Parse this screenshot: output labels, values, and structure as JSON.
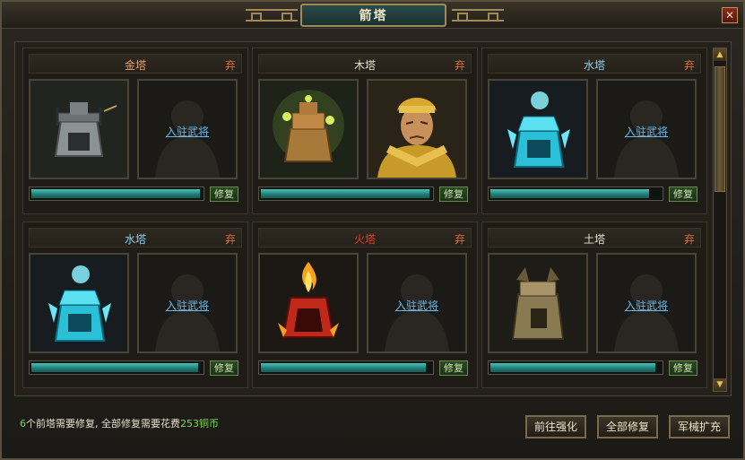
{
  "window": {
    "title": "箭塔",
    "close_label": "✕"
  },
  "towers": [
    {
      "name": "金塔",
      "name_color": "#e8a060",
      "drop_label": "弃",
      "tower_icon": "metal-tower-icon",
      "has_general": false,
      "assign_label": "入驻武将",
      "repair_label": "修复",
      "durability": 0.99
    },
    {
      "name": "木塔",
      "name_color": "#e8e0cc",
      "drop_label": "弃",
      "tower_icon": "wood-tower-icon",
      "has_general": true,
      "general_icon": "general-portrait",
      "repair_label": "修复",
      "durability": 0.99
    },
    {
      "name": "水塔",
      "name_color": "#8ad0f0",
      "drop_label": "弃",
      "tower_icon": "water-tower-icon",
      "has_general": false,
      "assign_label": "入驻武将",
      "repair_label": "修复",
      "durability": 0.93
    },
    {
      "name": "水塔",
      "name_color": "#8ad0f0",
      "drop_label": "弃",
      "tower_icon": "water-tower-icon",
      "has_general": false,
      "assign_label": "入驻武将",
      "repair_label": "修复",
      "durability": 0.98
    },
    {
      "name": "火塔",
      "name_color": "#e83a2a",
      "drop_label": "弃",
      "tower_icon": "fire-tower-icon",
      "has_general": false,
      "assign_label": "入驻武将",
      "repair_label": "修复",
      "durability": 0.97
    },
    {
      "name": "土塔",
      "name_color": "#e8e0cc",
      "drop_label": "弃",
      "tower_icon": "earth-tower-icon",
      "has_general": false,
      "assign_label": "入驻武将",
      "repair_label": "修复",
      "durability": 0.97
    }
  ],
  "footer": {
    "count": "6",
    "text_part1": "个前塔需要修复, 全部修复需要花费",
    "cost": "253",
    "currency": "铜币",
    "buttons": {
      "enhance": "前往强化",
      "repair_all": "全部修复",
      "expand": "军械扩充"
    }
  },
  "scrollbar": {
    "up_icon": "scroll-up-arrow-icon",
    "down_icon": "scroll-down-arrow-icon"
  }
}
